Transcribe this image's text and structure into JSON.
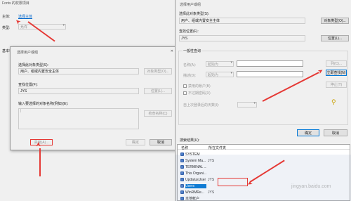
{
  "bg_window": {
    "title": "Fonts 的权限项目",
    "principal_label": "主体:",
    "principal_link": "选择主体",
    "type_label": "类型:",
    "type_value": "允许",
    "basic_perm_label": "基本权限"
  },
  "dialog_small": {
    "title": "选择用户或组",
    "object_type_label": "选择此对象类型(S):",
    "object_type_value": "用户、组或内置安全主体",
    "object_type_btn": "对象类型(O)...",
    "location_label": "查找位置(F):",
    "location_value": "JYS",
    "location_btn": "位置(L)...",
    "names_label": "输入要选择的对象名称(例如)(E):",
    "names_link": "(例如)",
    "check_names_btn": "检查名称(C)",
    "advanced_btn": "高级(A)...",
    "ok_btn": "确定",
    "cancel_btn": "取消"
  },
  "dialog_large": {
    "title": "选择用户或组",
    "object_type_label": "选择此对象类型(S):",
    "object_type_value": "用户、组或内置安全主体",
    "object_type_btn": "对象类型(O)...",
    "location_label": "查找位置(F):",
    "location_value": "JYS",
    "location_btn": "位置(L)...",
    "common_query": "一般性查询",
    "name_label": "名称(A):",
    "name_mode": "起始为",
    "desc_label": "描述(D):",
    "desc_mode": "起始为",
    "disabled_label": "禁用的帐户(B)",
    "noexpire_label": "不过期密码(X)",
    "days_label": "自上次登录后的天数(I):",
    "columns_btn": "列(C)...",
    "find_now_btn": "立即查找(N)",
    "stop_btn": "停止(T)",
    "ok_btn": "确定",
    "cancel_btn": "取消",
    "results_label": "搜索结果(U):",
    "col_name": "名称",
    "col_folder": "所在文件夹",
    "results": [
      {
        "name": "SYSTEM",
        "folder": ""
      },
      {
        "name": "System Ma...",
        "folder": "JYS"
      },
      {
        "name": "TERMINAL ...",
        "folder": ""
      },
      {
        "name": "This Organi...",
        "folder": ""
      },
      {
        "name": "UpdatusUser",
        "folder": "JYS"
      },
      {
        "name": "Users",
        "folder": ""
      },
      {
        "name": "WinRMRe...",
        "folder": "JYS"
      },
      {
        "name": "本地帐户",
        "folder": ""
      }
    ]
  },
  "colors": {
    "highlight": "#0078d7",
    "annotation": "#e53935"
  }
}
